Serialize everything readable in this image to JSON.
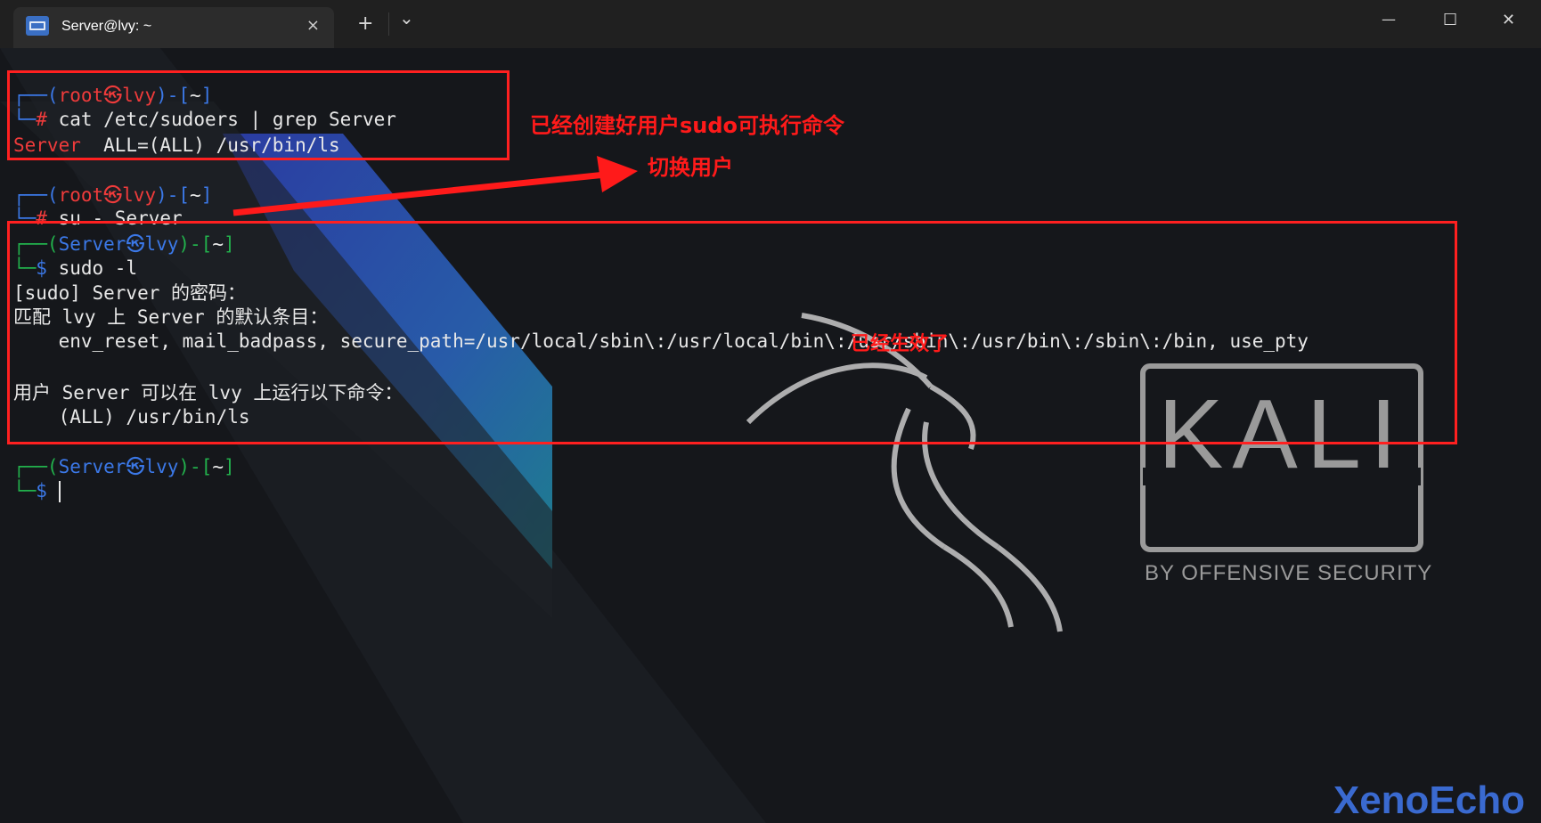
{
  "window": {
    "tab_title": "Server@lvy: ~",
    "tab_close_icon": "×",
    "new_tab_icon": "+",
    "dropdown_icon": "⌄",
    "minimize_icon": "—",
    "maximize_icon": "☐",
    "close_icon": "✕"
  },
  "terminal": {
    "l1_a": "┌──(",
    "l1_user": "root",
    "l1_skull": "㉿",
    "l1_host": "lvy",
    "l1_b": ")-[",
    "l1_path": "~",
    "l1_c": "]",
    "l2_a": "└─",
    "l2_prompt": "#",
    "l2_cmd": " cat /etc/sudoers | grep Server",
    "l3_user": "Server",
    "l3_rest": "  ALL=(ALL) /usr/bin/ls",
    "l4_a": "┌──(",
    "l4_user": "root",
    "l4_skull": "㉿",
    "l4_host": "lvy",
    "l4_b": ")-[",
    "l4_path": "~",
    "l4_c": "]",
    "l5_a": "└─",
    "l5_prompt": "#",
    "l5_cmd": " su - Server",
    "l6_a": "┌──(",
    "l6_user": "Server",
    "l6_skull": "㉿",
    "l6_host": "lvy",
    "l6_b": ")-[",
    "l6_path": "~",
    "l6_c": "]",
    "l7_a": "└─",
    "l7_prompt": "$",
    "l7_cmd": " sudo -l",
    "l8": "[sudo] Server 的密码：",
    "l9": "匹配 lvy 上 Server 的默认条目：",
    "l10": "    env_reset, mail_badpass, secure_path=/usr/local/sbin\\:/usr/local/bin\\:/usr/sbin\\:/usr/bin\\:/sbin\\:/bin, use_pty",
    "l11": "用户 Server 可以在 lvy 上运行以下命令：",
    "l12": "    (ALL) /usr/bin/ls",
    "l13_a": "┌──(",
    "l13_user": "Server",
    "l13_skull": "㉿",
    "l13_host": "lvy",
    "l13_b": ")-[",
    "l13_path": "~",
    "l13_c": "]",
    "l14_a": "└─",
    "l14_prompt": "$"
  },
  "annotations": {
    "note1": "已经创建好用户sudo可执行命令",
    "note2": "切换用户",
    "note3": "已经生效了"
  },
  "background": {
    "logo_text": "KALI",
    "logo_sub": "BY OFFENSIVE SECURITY"
  },
  "watermark": "XenoEcho",
  "colors": {
    "prompt_blue": "#3b78e7",
    "root_red": "#ef3b3b",
    "user_green": "#22b14c",
    "annotation_red": "#ff1a1a"
  }
}
